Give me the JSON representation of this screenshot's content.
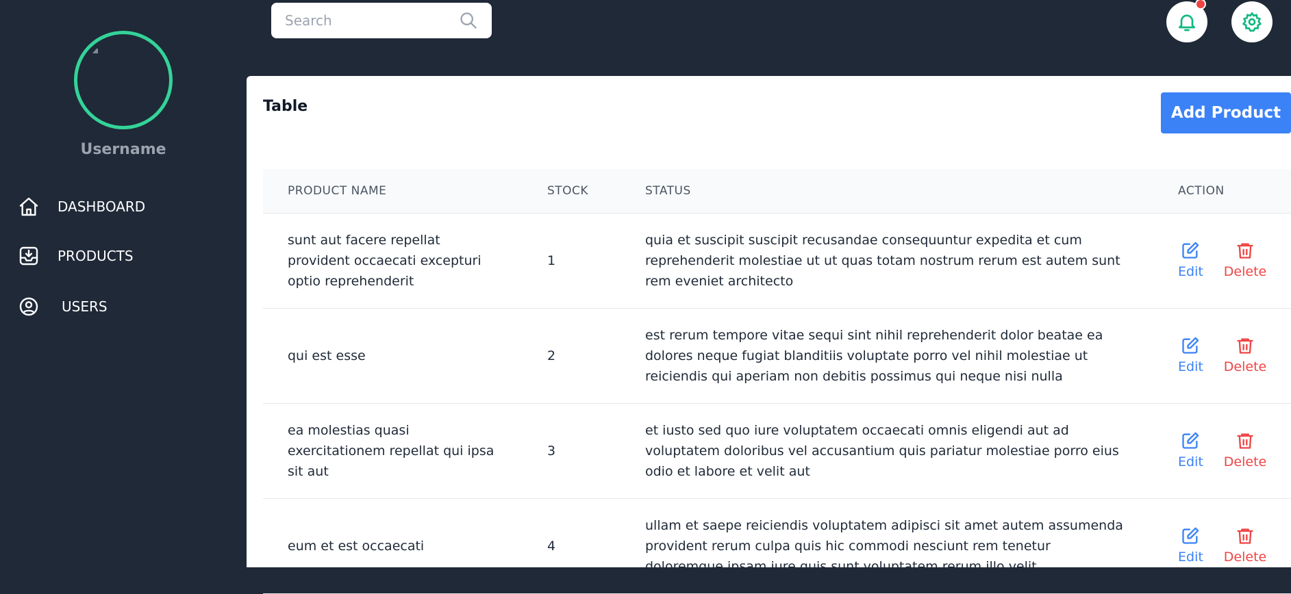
{
  "sidebar": {
    "username": "Username",
    "items": [
      {
        "label": "DASHBOARD",
        "icon": "home-icon"
      },
      {
        "label": "PRODUCTS",
        "icon": "download-tray-icon"
      },
      {
        "label": "USERS",
        "icon": "user-circle-icon"
      }
    ]
  },
  "header": {
    "search_placeholder": "Search",
    "search_icon": "search-icon",
    "notification_icon": "bell-icon",
    "settings_icon": "gear-icon"
  },
  "main": {
    "title": "Table",
    "add_button": "Add Product",
    "columns": [
      "PRODUCT NAME",
      "STOCK",
      "STATUS",
      "ACTION"
    ],
    "rows": [
      {
        "name": "sunt aut facere repellat provident occaecati excepturi optio reprehenderit",
        "stock": "1",
        "status": "quia et suscipit suscipit recusandae consequuntur expedita et cum reprehenderit molestiae ut ut quas totam nostrum rerum est autem sunt rem eveniet architecto",
        "edit": "Edit",
        "delete": "Delete"
      },
      {
        "name": "qui est esse",
        "stock": "2",
        "status": "est rerum tempore vitae sequi sint nihil reprehenderit dolor beatae ea dolores neque fugiat blanditiis voluptate porro vel nihil molestiae ut reiciendis qui aperiam non debitis possimus qui neque nisi nulla",
        "edit": "Edit",
        "delete": "Delete"
      },
      {
        "name": "ea molestias quasi exercitationem repellat qui ipsa sit aut",
        "stock": "3",
        "status": "et iusto sed quo iure voluptatem occaecati omnis eligendi aut ad voluptatem doloribus vel accusantium quis pariatur molestiae porro eius odio et labore et velit aut",
        "edit": "Edit",
        "delete": "Delete"
      },
      {
        "name": "eum et est occaecati",
        "stock": "4",
        "status": "ullam et saepe reiciendis voluptatem adipisci sit amet autem assumenda provident rerum culpa quis hic commodi nesciunt rem tenetur doloremque ipsam iure quis sunt voluptatem rerum illo velit",
        "edit": "Edit",
        "delete": "Delete"
      }
    ]
  },
  "colors": {
    "sidebar_bg": "#1f2937",
    "accent_green": "#34d399",
    "primary_blue": "#3b82f6",
    "danger_red": "#ef4444"
  }
}
